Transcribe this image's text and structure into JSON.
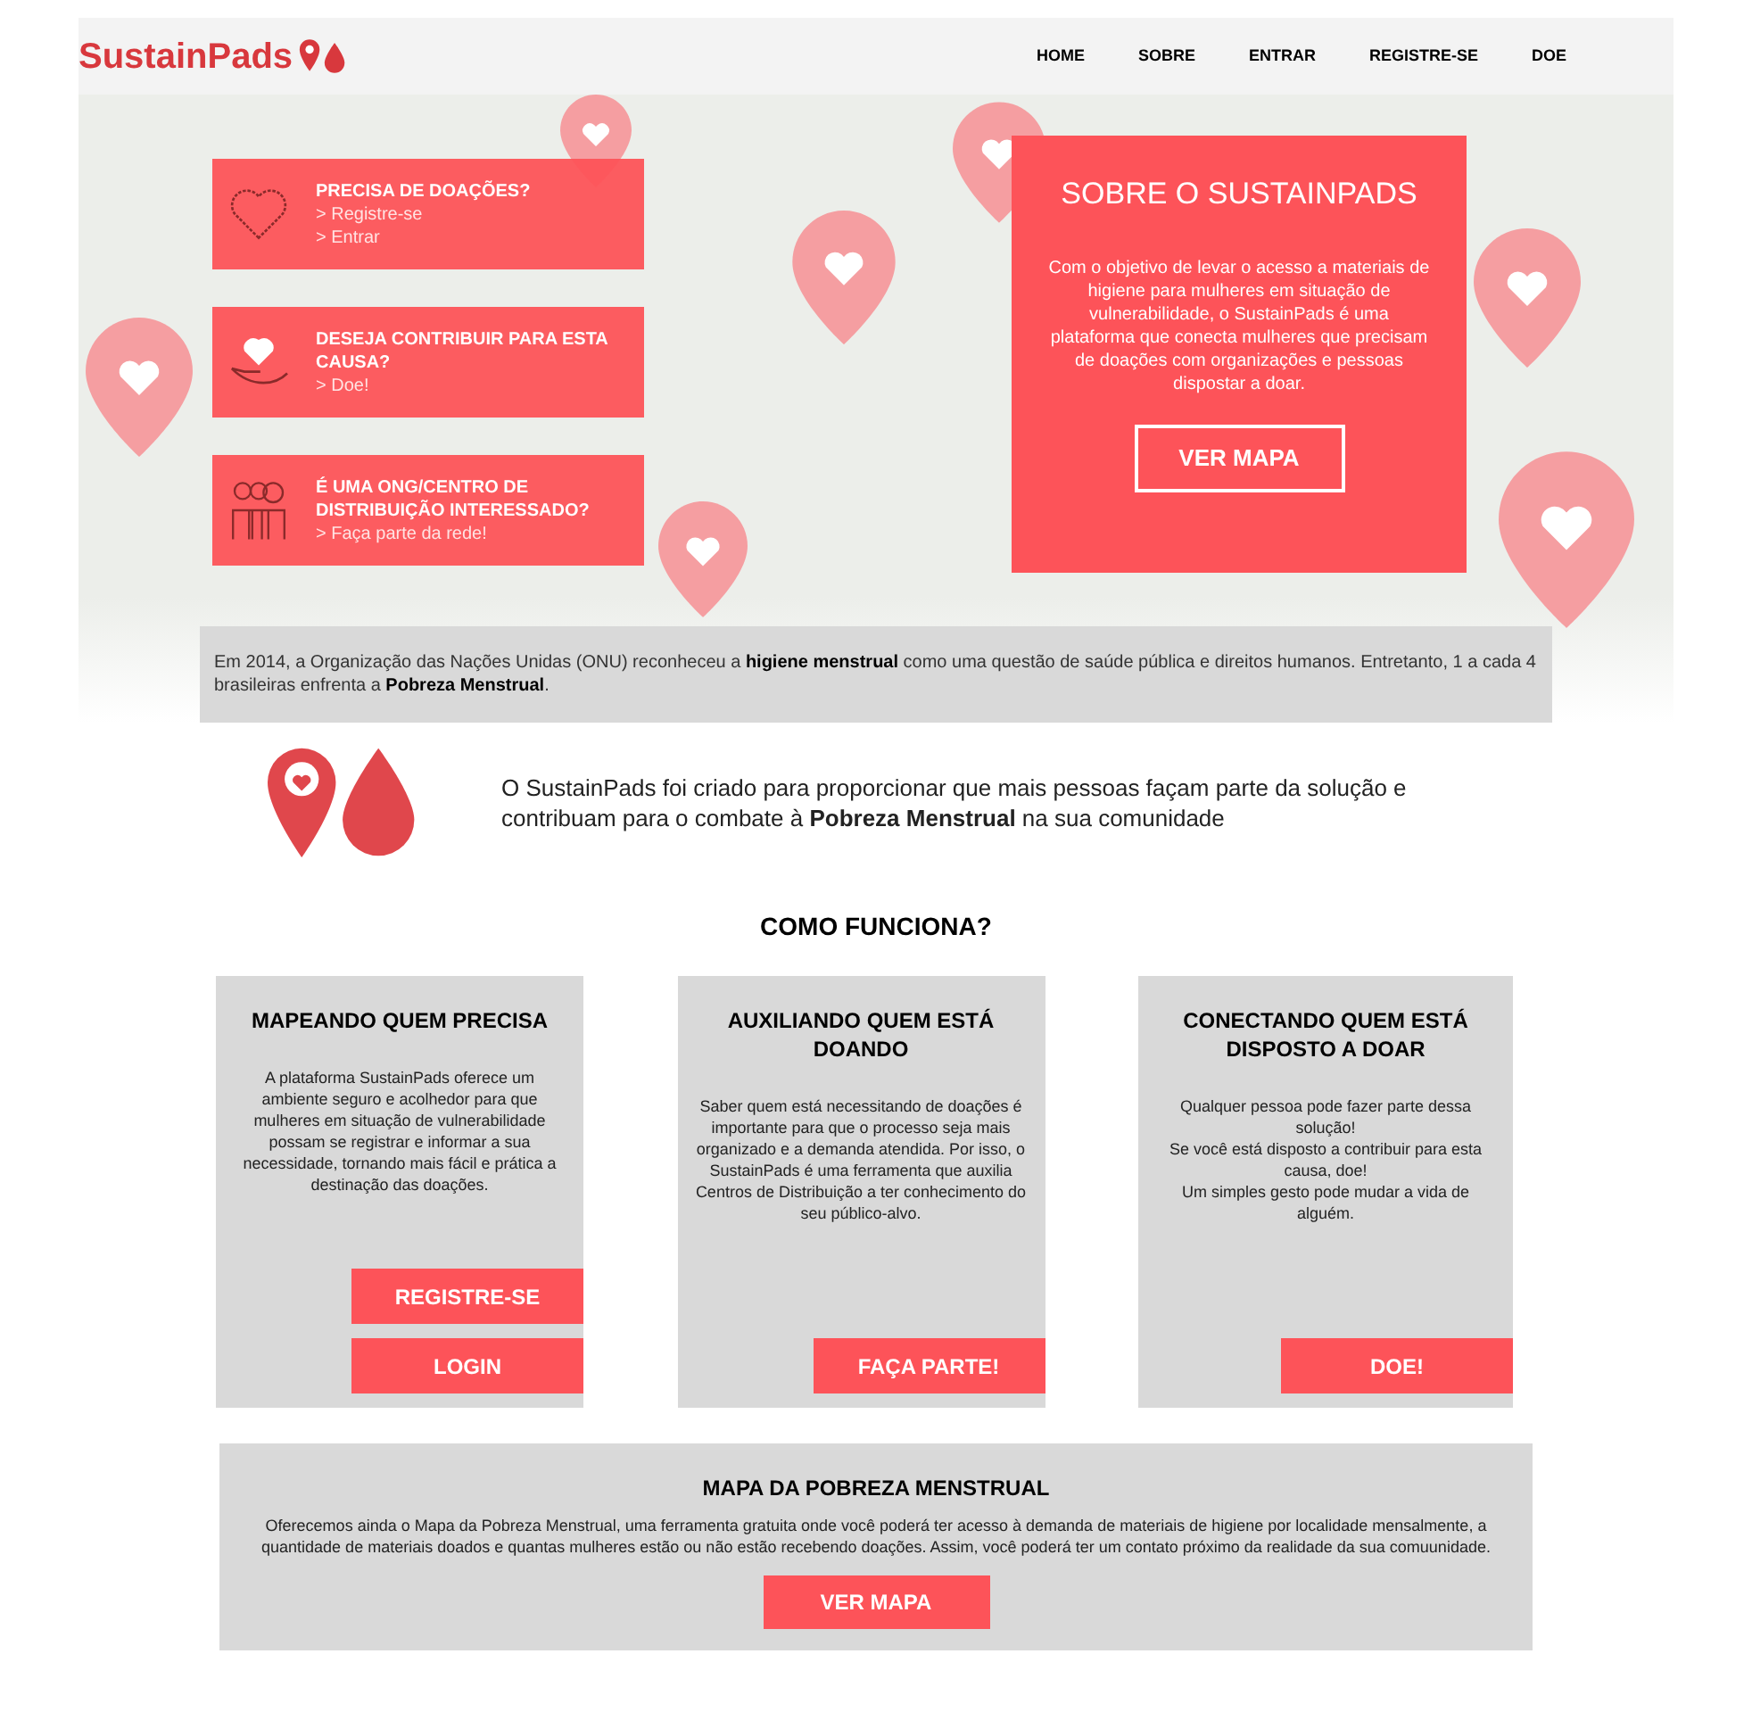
{
  "header": {
    "logo": "SustainPads",
    "nav": [
      "HOME",
      "SOBRE",
      "ENTRAR",
      "REGISTRE-SE",
      "DOE"
    ]
  },
  "hero": {
    "cards": [
      {
        "kind": "heart",
        "title": "PRECISA DE DOAÇÕES?",
        "links": [
          "> Registre-se",
          "> Entrar"
        ]
      },
      {
        "kind": "hand",
        "title": "DESEJA CONTRIBUIR PARA ESTA CAUSA?",
        "links": [
          "> Doe!"
        ]
      },
      {
        "kind": "people",
        "title": "É UMA ONG/CENTRO DE DISTRIBUIÇÃO INTERESSADO?",
        "links": [
          "> Faça parte da rede!"
        ]
      }
    ],
    "about": {
      "title": "SOBRE O SUSTAINPADS",
      "text": "Com o objetivo de levar o acesso a materiais de higiene para mulheres em situação de vulnerabilidade, o SustainPads é uma plataforma que conecta mulheres que precisam de doações com organizações e pessoas dispostar a doar.",
      "button": "VER MAPA"
    }
  },
  "notice": "Em 2014, a Organização das Nações Unidas (ONU) reconheceu a **higiene menstrual** como uma questão de saúde pública e direitos humanos. Entretanto, 1 a cada 4 brasileiras enfrenta a **Pobreza Menstrual**.",
  "intro": "O SustainPads foi criado para proporcionar que mais pessoas façam parte da solução e contribuam para o combate à **Pobreza Menstrual** na sua comunidade",
  "how": {
    "title": "COMO FUNCIONA?",
    "cards": [
      {
        "title": "MAPEANDO QUEM PRECISA",
        "text": "A plataforma SustainPads oferece um ambiente seguro e acolhedor para que mulheres em situação de vulnerabilidade possam se registrar e informar a sua necessidade, tornando mais fácil e prática a destinação das doações.",
        "buttons": [
          "REGISTRE-SE",
          "LOGIN"
        ]
      },
      {
        "title": "AUXILIANDO QUEM ESTÁ DOANDO",
        "text": "Saber quem está necessitando de doações é importante para que o processo seja mais organizado e a demanda atendida. Por isso, o SustainPads é uma ferramenta que auxilia Centros de Distribuição a ter conhecimento do seu público-alvo.",
        "buttons": [
          "FAÇA PARTE!"
        ]
      },
      {
        "title": "CONECTANDO QUEM ESTÁ DISPOSTO A DOAR",
        "text": "Qualquer pessoa pode fazer parte dessa solução!\nSe você está disposto a contribuir para esta causa, doe!\nUm simples gesto pode mudar a vida de alguém.",
        "buttons": [
          "DOE!"
        ]
      }
    ]
  },
  "map_section": {
    "title": "MAPA DA POBREZA MENSTRUAL",
    "text": "Oferecemos ainda o Mapa da Pobreza Menstrual, uma ferramenta gratuita onde você poderá ter acesso à demanda de materiais de higiene por localidade mensalmente, a quantidade de materiais doados e quantas mulheres estão ou não estão recebendo doações. Assim, você poderá ter um contato próximo da realidade da sua comuunidade.",
    "button": "VER MAPA"
  }
}
